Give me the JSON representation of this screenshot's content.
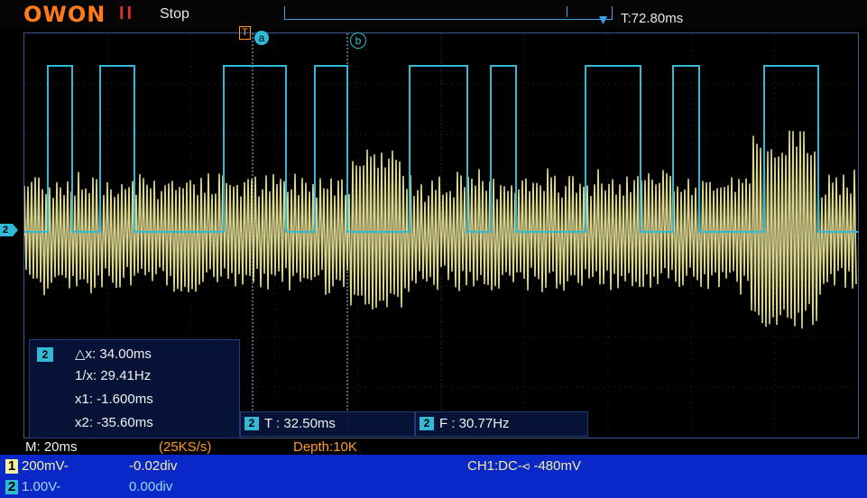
{
  "header": {
    "brand": "OWON",
    "run_indicator": "II",
    "status": "Stop",
    "trigger_position": "T:72.80ms"
  },
  "cursors": {
    "a_label": "a",
    "b_label": "b",
    "trigger_label": "T"
  },
  "channel_markers": {
    "ch2": "2"
  },
  "measurement_panel": {
    "channel": "2",
    "delta_x": "△x: 34.00ms",
    "inv_x": "1/x: 29.41Hz",
    "x1": "x1: -1.600ms",
    "x2": "x2: -35.60ms"
  },
  "period_readout": {
    "channel": "2",
    "text": "T : 32.50ms"
  },
  "freq_readout": {
    "channel": "2",
    "text": "F : 30.77Hz"
  },
  "timebase": {
    "main": "M: 20ms",
    "sample_rate": "(25KS/s)",
    "depth": "Depth:10K"
  },
  "ch1": {
    "num": "1",
    "scale": "200mV-",
    "offset": "-0.02div"
  },
  "ch2": {
    "num": "2",
    "scale": "1.00V-",
    "offset": "0.00div"
  },
  "trigger": {
    "text": "CH1:DC-⪦ -480mV"
  },
  "colors": {
    "ch1": "#f4f0a0",
    "ch2": "#31b9d6",
    "accent": "#ff7a1a",
    "footer_bg": "#0a28c8"
  }
}
